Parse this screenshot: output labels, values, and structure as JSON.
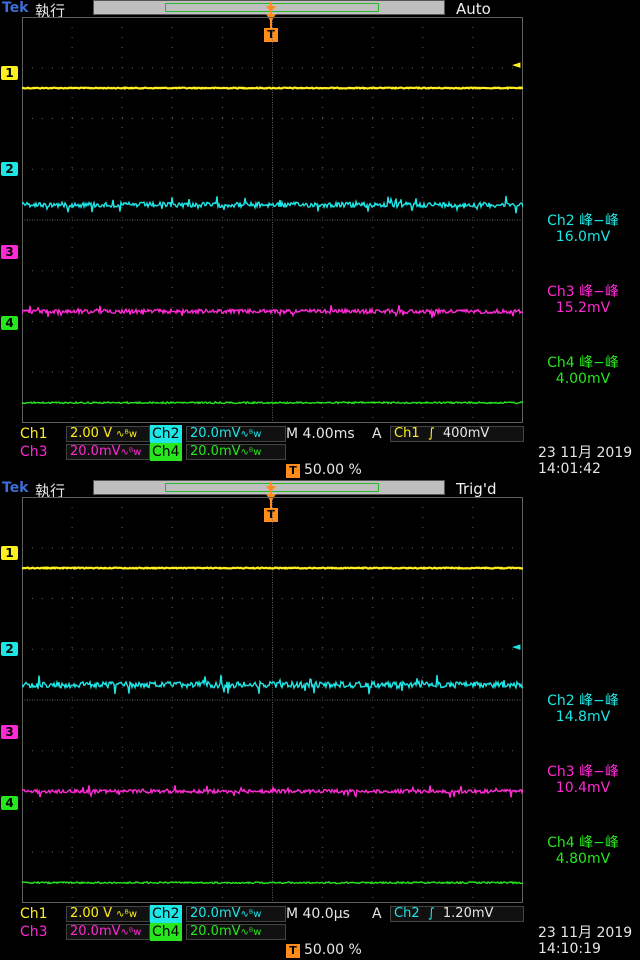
{
  "colors": {
    "ch1": "#ffef1e",
    "ch2": "#1ee6e6",
    "ch3": "#ff2ad4",
    "ch4": "#28e61e",
    "trigger": "#ff8c1a",
    "grid": "#5f5f5f"
  },
  "screens": [
    {
      "brand": "Tek",
      "run_mode": "執行",
      "trigger_state": "Auto",
      "trigger_marker": "T",
      "channels": [
        {
          "marker": "1",
          "row": 1.4
        },
        {
          "marker": "2",
          "row": 3.7
        },
        {
          "marker": "3",
          "row": 5.8
        },
        {
          "marker": "4",
          "row": 7.6
        }
      ],
      "noise": [
        0.5,
        2.5,
        2.0,
        0.8
      ],
      "measurements": [
        {
          "label": "Ch2 峰−峰",
          "value": "16.0mV"
        },
        {
          "label": "Ch3 峰−峰",
          "value": "15.2mV"
        },
        {
          "label": "Ch4 峰−峰",
          "value": "4.00mV"
        }
      ],
      "status": {
        "ch1_label": "Ch1",
        "ch1_scale": "2.00 V",
        "ch2_label": "Ch2",
        "ch2_scale": "20.0mV",
        "ch3_label": "Ch3",
        "ch3_scale": "20.0mV",
        "ch4_label": "Ch4",
        "ch4_scale": "20.0mV",
        "bw_icon": "∿ᴮw",
        "timebase": "M 4.00ms",
        "acq": "A",
        "trig_source": "Ch1",
        "trig_slope": "∫",
        "trig_level": "400mV",
        "trig_pos": "50.00 %",
        "date": "23 11月 2019",
        "time": "14:01:42"
      }
    },
    {
      "brand": "Tek",
      "run_mode": "執行",
      "trigger_state": "Trig'd",
      "trigger_marker": "T",
      "channels": [
        {
          "marker": "1",
          "row": 1.4
        },
        {
          "marker": "2",
          "row": 3.7
        },
        {
          "marker": "3",
          "row": 5.8
        },
        {
          "marker": "4",
          "row": 7.6
        }
      ],
      "noise": [
        0.5,
        3.0,
        1.8,
        0.8
      ],
      "measurements": [
        {
          "label": "Ch2 峰−峰",
          "value": "14.8mV"
        },
        {
          "label": "Ch3 峰−峰",
          "value": "10.4mV"
        },
        {
          "label": "Ch4 峰−峰",
          "value": "4.80mV"
        }
      ],
      "status": {
        "ch1_label": "Ch1",
        "ch1_scale": "2.00 V",
        "ch2_label": "Ch2",
        "ch2_scale": "20.0mV",
        "ch3_label": "Ch3",
        "ch3_scale": "20.0mV",
        "ch4_label": "Ch4",
        "ch4_scale": "20.0mV",
        "bw_icon": "∿ᴮw",
        "timebase": "M 40.0µs",
        "acq": "A",
        "trig_source": "Ch2",
        "trig_slope": "∫",
        "trig_level": "1.20mV",
        "trig_pos": "50.00 %",
        "date": "23 11月 2019",
        "time": "14:10:19"
      }
    }
  ]
}
